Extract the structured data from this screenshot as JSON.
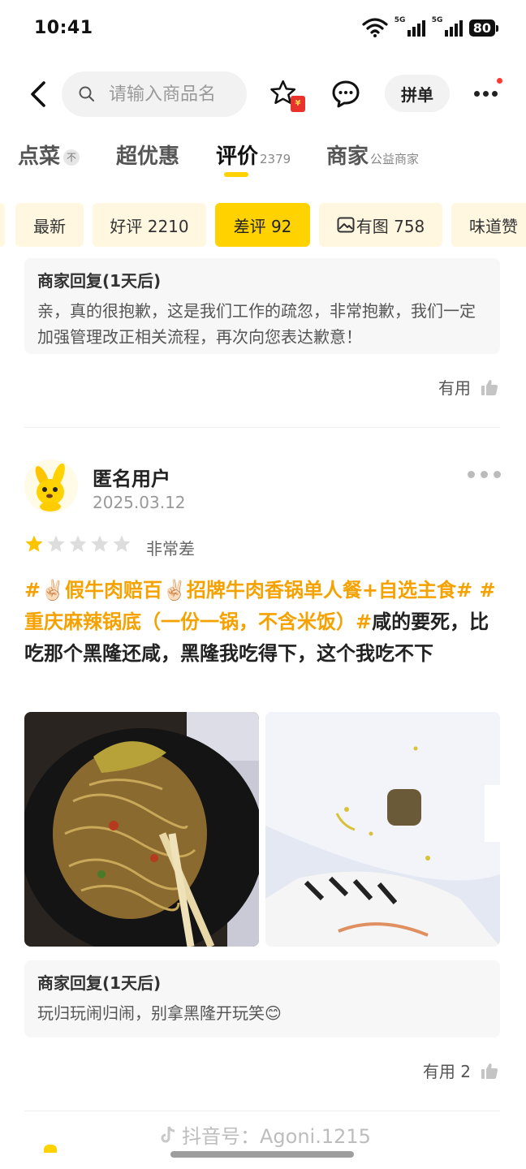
{
  "status_bar": {
    "time": "10:41",
    "network1": "5G",
    "network2": "5G",
    "battery": "80"
  },
  "search": {
    "placeholder": "请输入商品名"
  },
  "nav": {
    "coupon_glyph": "¥",
    "pindan_label": "拼单"
  },
  "tabs": [
    {
      "label": "点菜",
      "badge": "不"
    },
    {
      "label": "超优惠"
    },
    {
      "label": "评价",
      "count": "2379",
      "active": true
    },
    {
      "label": "商家",
      "sub": "公益商家"
    }
  ],
  "chips": [
    {
      "label": "最新"
    },
    {
      "label": "好评 2210"
    },
    {
      "label": "差评 92",
      "active": true
    },
    {
      "label": "有图 758"
    },
    {
      "label": "味道赞"
    }
  ],
  "reply1": {
    "title": "商家回复(1天后)",
    "text": "亲，真的很抱歉，这是我们工作的疏忽，非常抱歉，我们一定加强管理改正相关流程，再次向您表达歉意！"
  },
  "useful1": {
    "label": "有用"
  },
  "review": {
    "user": "匿名用户",
    "date": "2025.03.12",
    "rating": 1,
    "rating_max": 5,
    "rating_label": "非常差",
    "tag1": "#✌🏻假牛肉赔百✌🏻招牌牛肉香锅单人餐+自选主食",
    "tag2": "# #重庆麻辣锅底（一份一锅，不含米饭）#",
    "body": "咸的要死，比吃那个黑隆还咸，黑隆我吃得下，这个我吃不下"
  },
  "reply2": {
    "title": "商家回复(1天后)",
    "text": "玩归玩闹归闹，别拿黑隆开玩笑😊"
  },
  "useful2": {
    "label": "有用 2"
  },
  "watermark": {
    "text": "抖音号：Agoni.1215"
  },
  "colors": {
    "accent": "#ffd200",
    "tag": "#f5a200",
    "chip_bg": "#fff7e0"
  }
}
